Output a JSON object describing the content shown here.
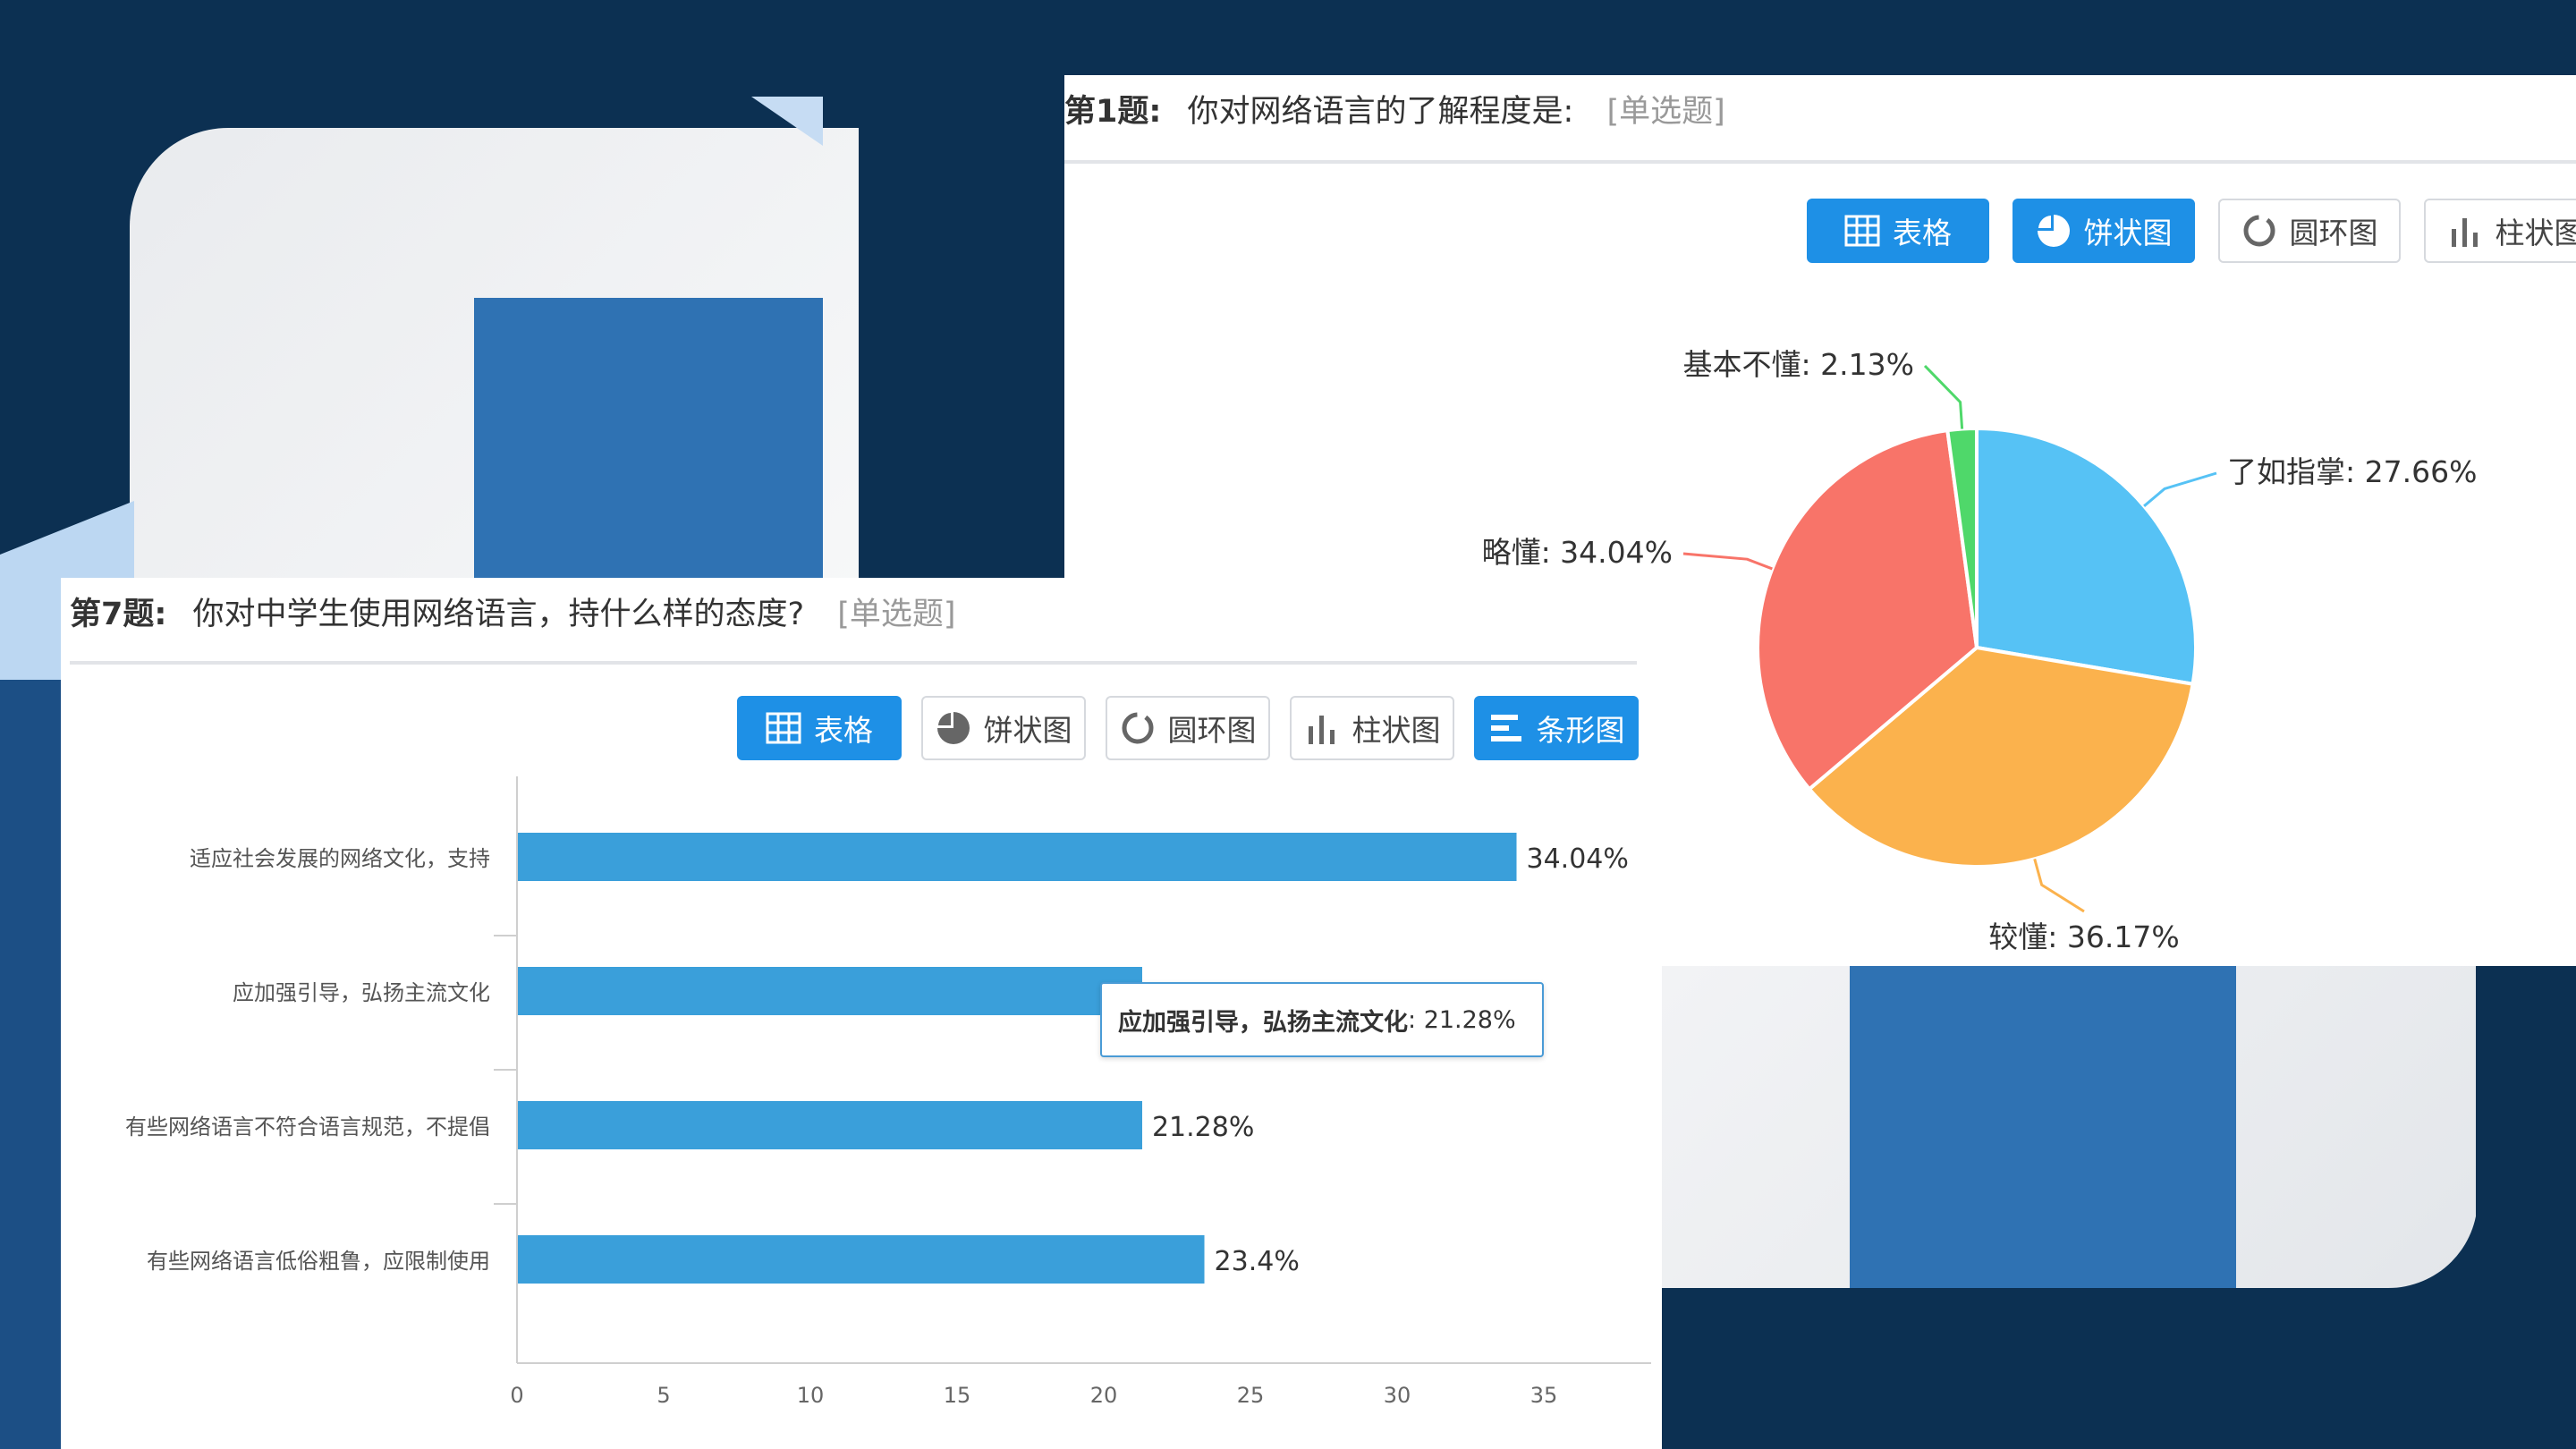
{
  "colors": {
    "background": "#0c3052",
    "accent_blue": "#2f72b3",
    "button_active": "#1e90e6",
    "bar": "#3a9fda"
  },
  "question1": {
    "number": "第1题:",
    "text": "你对网络语言的了解程度是:",
    "tag": "[单选题]",
    "buttons": [
      {
        "label": "表格",
        "icon": "table-icon",
        "active": true
      },
      {
        "label": "饼状图",
        "icon": "pie-chart-icon",
        "active": true
      },
      {
        "label": "圆环图",
        "icon": "donut-chart-icon",
        "active": false
      },
      {
        "label": "柱状图",
        "icon": "column-chart-icon",
        "active": false
      }
    ]
  },
  "question7": {
    "number": "第7题:",
    "text": "你对中学生使用网络语言，持什么样的态度?",
    "tag": "[单选题]",
    "buttons": [
      {
        "label": "表格",
        "icon": "table-icon",
        "active": true
      },
      {
        "label": "饼状图",
        "icon": "pie-chart-icon",
        "active": false
      },
      {
        "label": "圆环图",
        "icon": "donut-chart-icon",
        "active": false
      },
      {
        "label": "柱状图",
        "icon": "column-chart-icon",
        "active": false
      },
      {
        "label": "条形图",
        "icon": "bar-chart-icon",
        "active": true
      }
    ],
    "tooltip": {
      "label": "应加强引导，弘扬主流文化",
      "value": "21.28%"
    }
  },
  "chart_data": [
    {
      "type": "pie",
      "slices": [
        {
          "label": "了如指掌",
          "value": 27.66,
          "display": "了如指掌: 27.66%",
          "color": "#56c2f5"
        },
        {
          "label": "较懂",
          "value": 36.17,
          "display": "较懂: 36.17%",
          "color": "#fbb24d"
        },
        {
          "label": "略懂",
          "value": 34.04,
          "display": "略懂: 34.04%",
          "color": "#f87469"
        },
        {
          "label": "基本不懂",
          "value": 2.13,
          "display": "基本不懂: 2.13%",
          "color": "#4fd86a"
        }
      ]
    },
    {
      "type": "bar",
      "orientation": "horizontal",
      "categories": [
        "适应社会发展的网络文化，支持",
        "应加强引导，弘扬主流文化",
        "有些网络语言不符合语言规范，不提倡",
        "有些网络语言低俗粗鲁，应限制使用"
      ],
      "values": [
        34.04,
        21.28,
        21.28,
        23.4
      ],
      "value_labels": [
        "34.04%",
        "",
        "21.28%",
        "23.4%"
      ],
      "xlim": [
        0,
        35
      ],
      "xticks": [
        "0",
        "5",
        "10",
        "15",
        "20",
        "25",
        "30",
        "35"
      ],
      "color": "#3a9fda"
    }
  ]
}
